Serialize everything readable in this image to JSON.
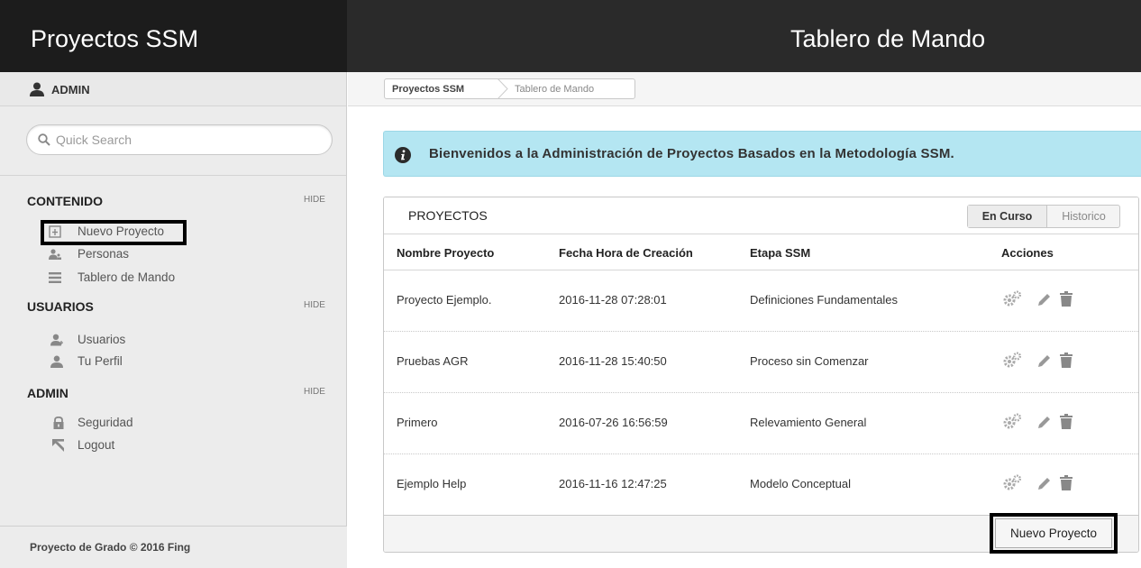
{
  "app": {
    "title": "Proyectos SSM",
    "page_title": "Tablero de Mando"
  },
  "user": {
    "name": "ADMIN",
    "icon": "user-icon"
  },
  "search": {
    "placeholder": "Quick Search",
    "value": ""
  },
  "sidebar": {
    "sections": [
      {
        "title": "CONTENIDO",
        "hide_label": "HIDE",
        "items": [
          {
            "label": "Nuevo Proyecto",
            "icon": "new-document-icon"
          },
          {
            "label": "Personas",
            "icon": "people-icon"
          },
          {
            "label": "Tablero de Mando",
            "icon": "list-icon"
          }
        ]
      },
      {
        "title": "USUARIOS",
        "hide_label": "HIDE",
        "items": [
          {
            "label": "Usuarios",
            "icon": "add-user-icon"
          },
          {
            "label": "Tu Perfil",
            "icon": "user-icon"
          }
        ]
      },
      {
        "title": "ADMIN",
        "hide_label": "HIDE",
        "items": [
          {
            "label": "Seguridad",
            "icon": "lock-icon"
          },
          {
            "label": "Logout",
            "icon": "arrow-up-left-icon"
          }
        ]
      }
    ],
    "footer": "Proyecto de Grado © 2016 Fing"
  },
  "breadcrumb": [
    "Proyectos SSM",
    "Tablero de Mando"
  ],
  "alert": {
    "text": "Bienvenidos a la Administración de Proyectos Basados en la Metodología SSM.",
    "icon": "info-icon"
  },
  "panel": {
    "title": "PROYECTOS",
    "tabs": [
      {
        "label": "En Curso",
        "active": true
      },
      {
        "label": "Historico",
        "active": false
      }
    ],
    "columns": [
      "Nombre Proyecto",
      "Fecha Hora de Creación",
      "Etapa SSM",
      "Acciones"
    ],
    "rows": [
      {
        "name": "Proyecto Ejemplo.",
        "date": "2016-11-28 07:28:01",
        "stage": "Definiciones Fundamentales"
      },
      {
        "name": "Pruebas AGR",
        "date": "2016-11-28 15:40:50",
        "stage": "Proceso sin Comenzar"
      },
      {
        "name": "Primero",
        "date": "2016-07-26 16:56:59",
        "stage": "Relevamiento General"
      },
      {
        "name": "Ejemplo Help",
        "date": "2016-11-16 12:47:25",
        "stage": "Modelo Conceptual"
      }
    ],
    "row_actions": [
      "gears-icon",
      "pencil-icon",
      "trash-icon"
    ],
    "new_button": "Nuevo Proyecto"
  },
  "colors": {
    "topbar": "#1c1c1c",
    "sidebar": "#ececec",
    "alert_bg": "#b4e6f2",
    "highlight": "#000000"
  }
}
